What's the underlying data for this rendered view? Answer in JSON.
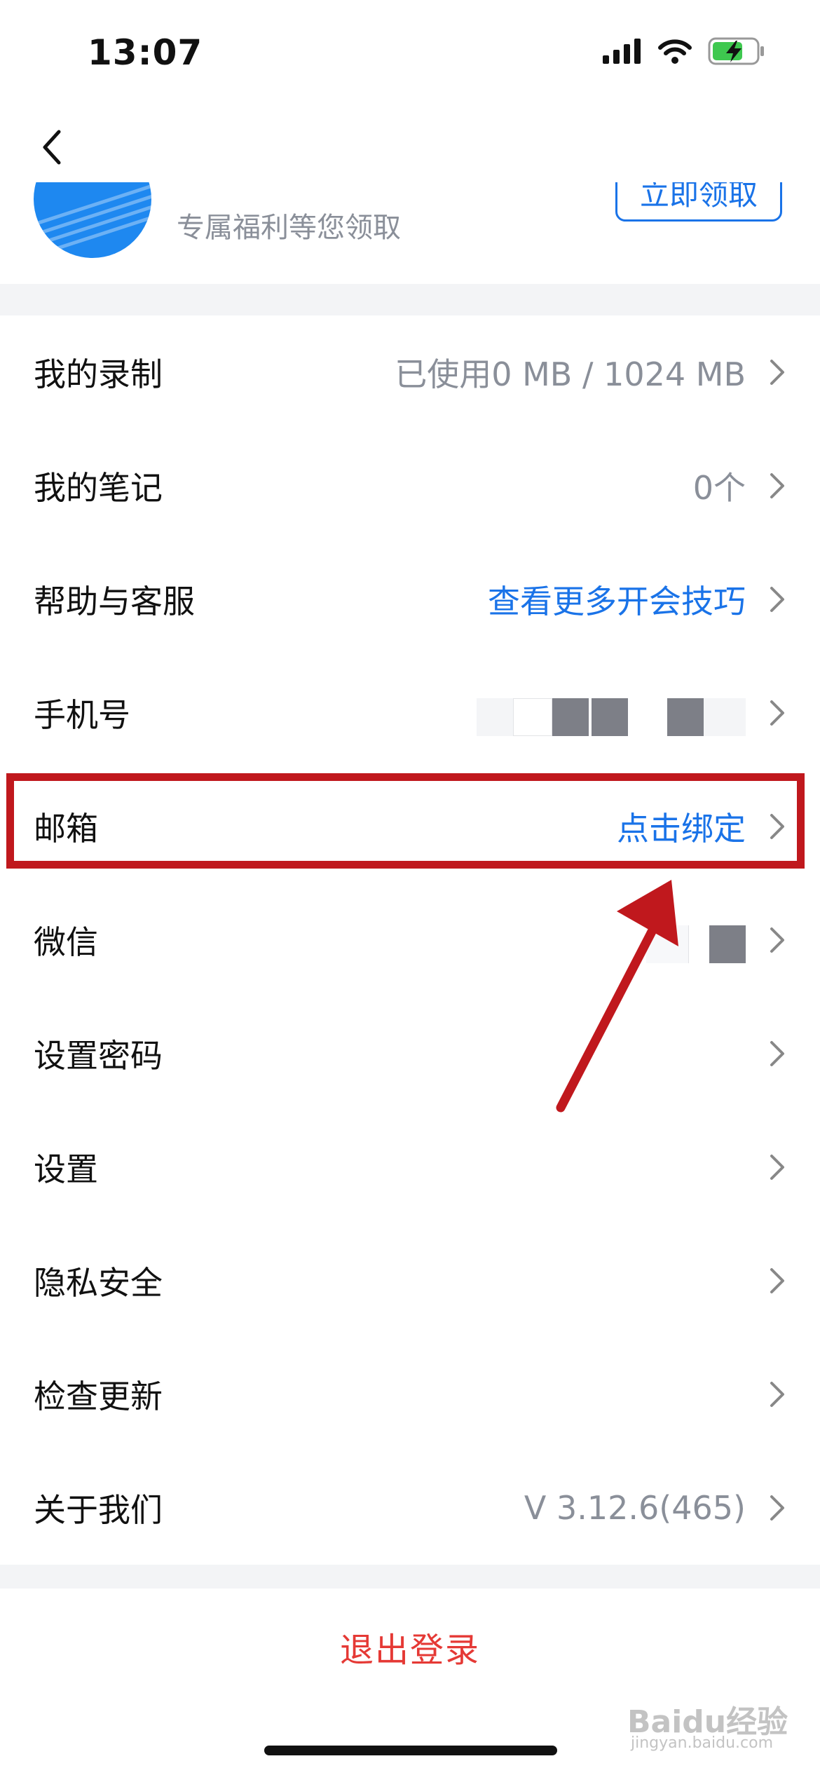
{
  "status_bar": {
    "time": "13:07"
  },
  "promo": {
    "subtitle": "专属福利等您领取",
    "claim_label": "立即领取"
  },
  "menu": [
    {
      "label": "我的录制",
      "value": "已使用0 MB / 1024 MB",
      "value_style": "gray"
    },
    {
      "label": "我的笔记",
      "value": "0个",
      "value_style": "gray"
    },
    {
      "label": "帮助与客服",
      "value": "查看更多开会技巧",
      "value_style": "blue"
    },
    {
      "label": "手机号",
      "value": "",
      "value_style": "masked"
    },
    {
      "label": "邮箱",
      "value": "点击绑定",
      "value_style": "blue"
    },
    {
      "label": "微信",
      "value": "",
      "value_style": "masked"
    },
    {
      "label": "设置密码",
      "value": "",
      "value_style": "gray"
    },
    {
      "label": "设置",
      "value": "",
      "value_style": "gray"
    },
    {
      "label": "隐私安全",
      "value": "",
      "value_style": "gray"
    },
    {
      "label": "检查更新",
      "value": "",
      "value_style": "gray"
    },
    {
      "label": "关于我们",
      "value": "V 3.12.6(465)",
      "value_style": "gray"
    }
  ],
  "logout_label": "退出登录",
  "watermark": {
    "brand": "Baidu经验",
    "url": "jingyan.baidu.com"
  },
  "colors": {
    "accent_blue": "#1a73e8",
    "logout_red": "#e53935",
    "annotation_red": "#c0181d"
  }
}
